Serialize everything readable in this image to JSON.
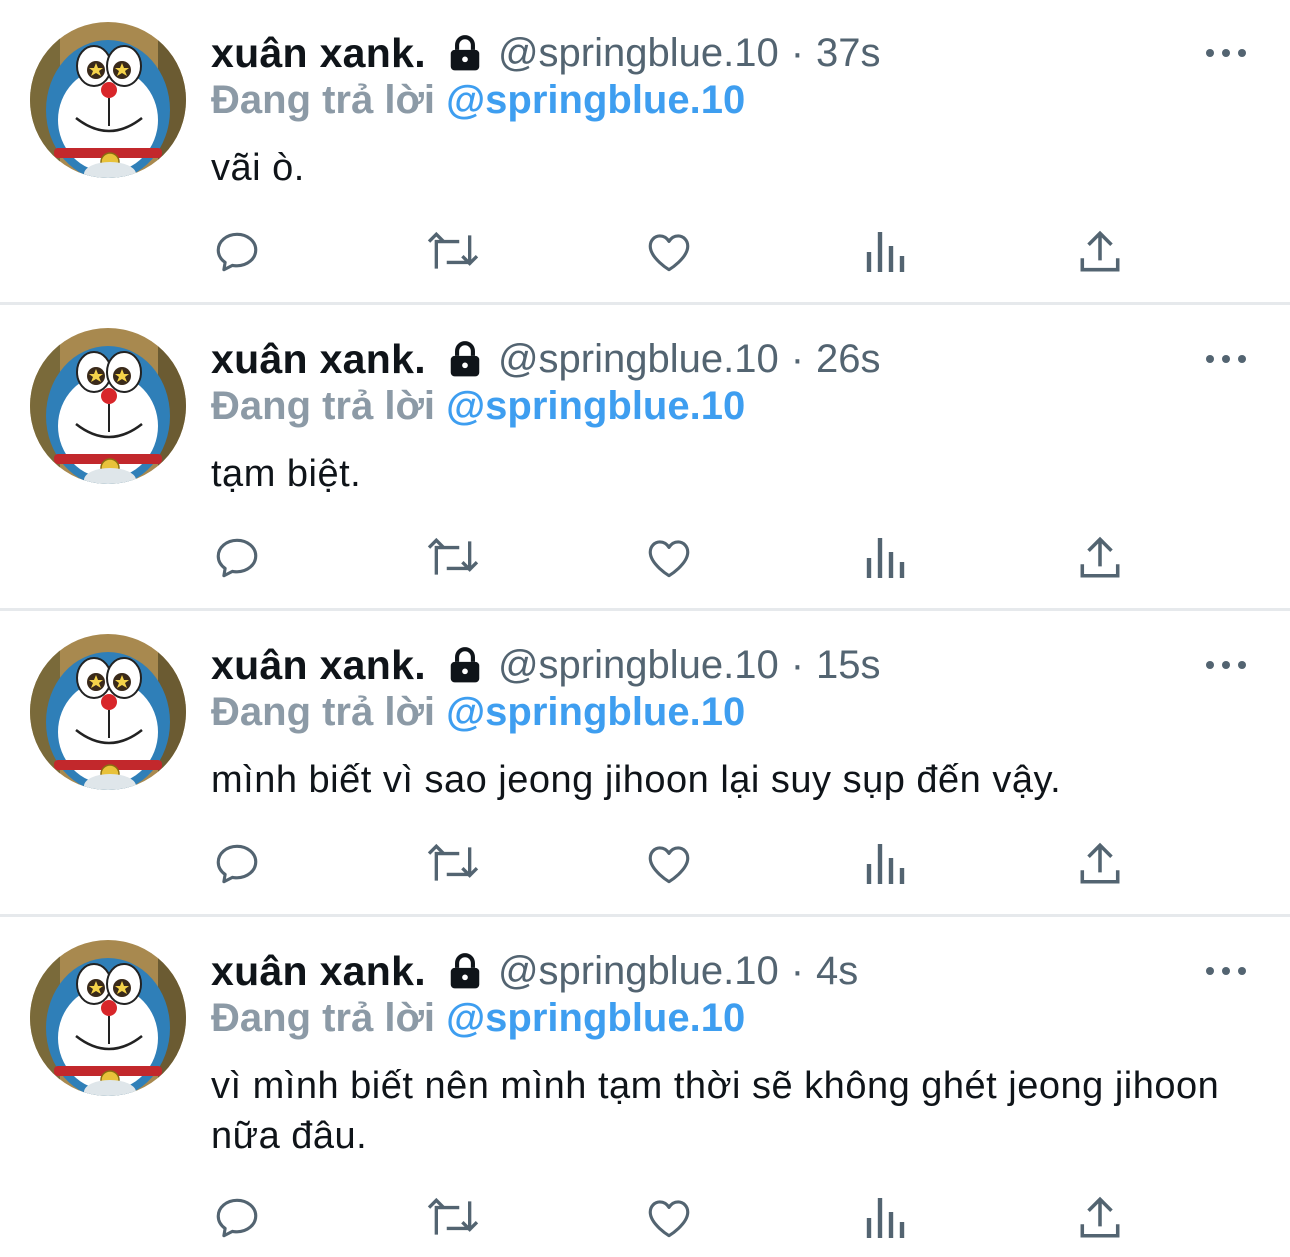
{
  "colors": {
    "name": "#0f1419",
    "secondary": "#536471",
    "replying_label": "#8c9aa6",
    "mention": "#3e9ef0",
    "divider": "#e6e9ec"
  },
  "tweets": [
    {
      "author_name": "xuân xank.",
      "author_handle": "@springblue.10",
      "separator": "·",
      "time": "37s",
      "replying_label": "Đang trả lời",
      "replying_to": "@springblue.10",
      "text": "vãi ò.",
      "icons": [
        "lock-icon",
        "more-icon",
        "reply-icon",
        "retweet-icon",
        "like-icon",
        "views-icon",
        "share-icon"
      ]
    },
    {
      "author_name": "xuân xank.",
      "author_handle": "@springblue.10",
      "separator": "·",
      "time": "26s",
      "replying_label": "Đang trả lời",
      "replying_to": "@springblue.10",
      "text": "tạm biệt.",
      "icons": [
        "lock-icon",
        "more-icon",
        "reply-icon",
        "retweet-icon",
        "like-icon",
        "views-icon",
        "share-icon"
      ]
    },
    {
      "author_name": "xuân xank.",
      "author_handle": "@springblue.10",
      "separator": "·",
      "time": "15s",
      "replying_label": "Đang trả lời",
      "replying_to": "@springblue.10",
      "text": "mình biết vì sao jeong jihoon lại suy sụp đến vậy.",
      "icons": [
        "lock-icon",
        "more-icon",
        "reply-icon",
        "retweet-icon",
        "like-icon",
        "views-icon",
        "share-icon"
      ]
    },
    {
      "author_name": "xuân xank.",
      "author_handle": "@springblue.10",
      "separator": "·",
      "time": "4s",
      "replying_label": "Đang trả lời",
      "replying_to": "@springblue.10",
      "text": "vì mình biết nên mình tạm thời sẽ không ghét jeong jihoon nữa đâu.",
      "icons": [
        "lock-icon",
        "more-icon",
        "reply-icon",
        "retweet-icon",
        "like-icon",
        "views-icon",
        "share-icon"
      ]
    }
  ]
}
